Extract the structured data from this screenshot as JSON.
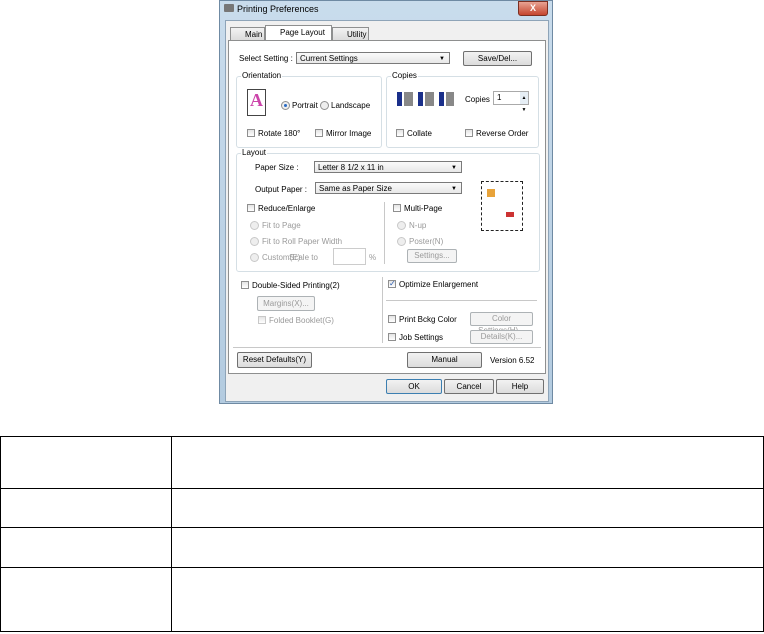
{
  "window": {
    "title": "Printing Preferences",
    "close": "X"
  },
  "tabs": [
    {
      "label": "Main"
    },
    {
      "label": "Page Layout"
    },
    {
      "label": "Utility"
    }
  ],
  "select_setting": {
    "label": "Select Setting :",
    "value": "Current Settings",
    "save_button": "Save/Del..."
  },
  "orientation": {
    "title": "Orientation",
    "portrait": "Portrait",
    "landscape": "Landscape",
    "rotate": "Rotate 180°",
    "mirror": "Mirror Image",
    "selected": "Portrait"
  },
  "copies": {
    "title": "Copies",
    "label": "Copies",
    "value": "1",
    "collate": "Collate",
    "reverse": "Reverse Order"
  },
  "layout": {
    "title": "Layout",
    "paper_size_label": "Paper Size :",
    "paper_size": "Letter 8 1/2 x 11 in",
    "output_paper_label": "Output Paper :",
    "output_paper": "Same as Paper Size",
    "reduce_enlarge": "Reduce/Enlarge",
    "fit_page": "Fit to Page",
    "fit_roll": "Fit to Roll Paper Width",
    "custom": "Custom(E)",
    "scale_to": "Scale to",
    "percent": "%",
    "multi_page": "Multi-Page",
    "nup": "N-up",
    "poster": "Poster(N)",
    "settings": "Settings..."
  },
  "double_sided": {
    "label": "Double-Sided Printing(2)",
    "margins": "Margins(X)...",
    "folded": "Folded Booklet(G)"
  },
  "options": {
    "optimize": "Optimize Enlargement",
    "optimize_checked": true,
    "print_bkg": "Print Bckg Color",
    "color_settings": "Color Settings(H)...",
    "job_settings": "Job Settings",
    "details": "Details(K)..."
  },
  "footer": {
    "reset": "Reset Defaults(Y)",
    "manual": "Manual",
    "version": "Version 6.52",
    "ok": "OK",
    "cancel": "Cancel",
    "help": "Help"
  }
}
